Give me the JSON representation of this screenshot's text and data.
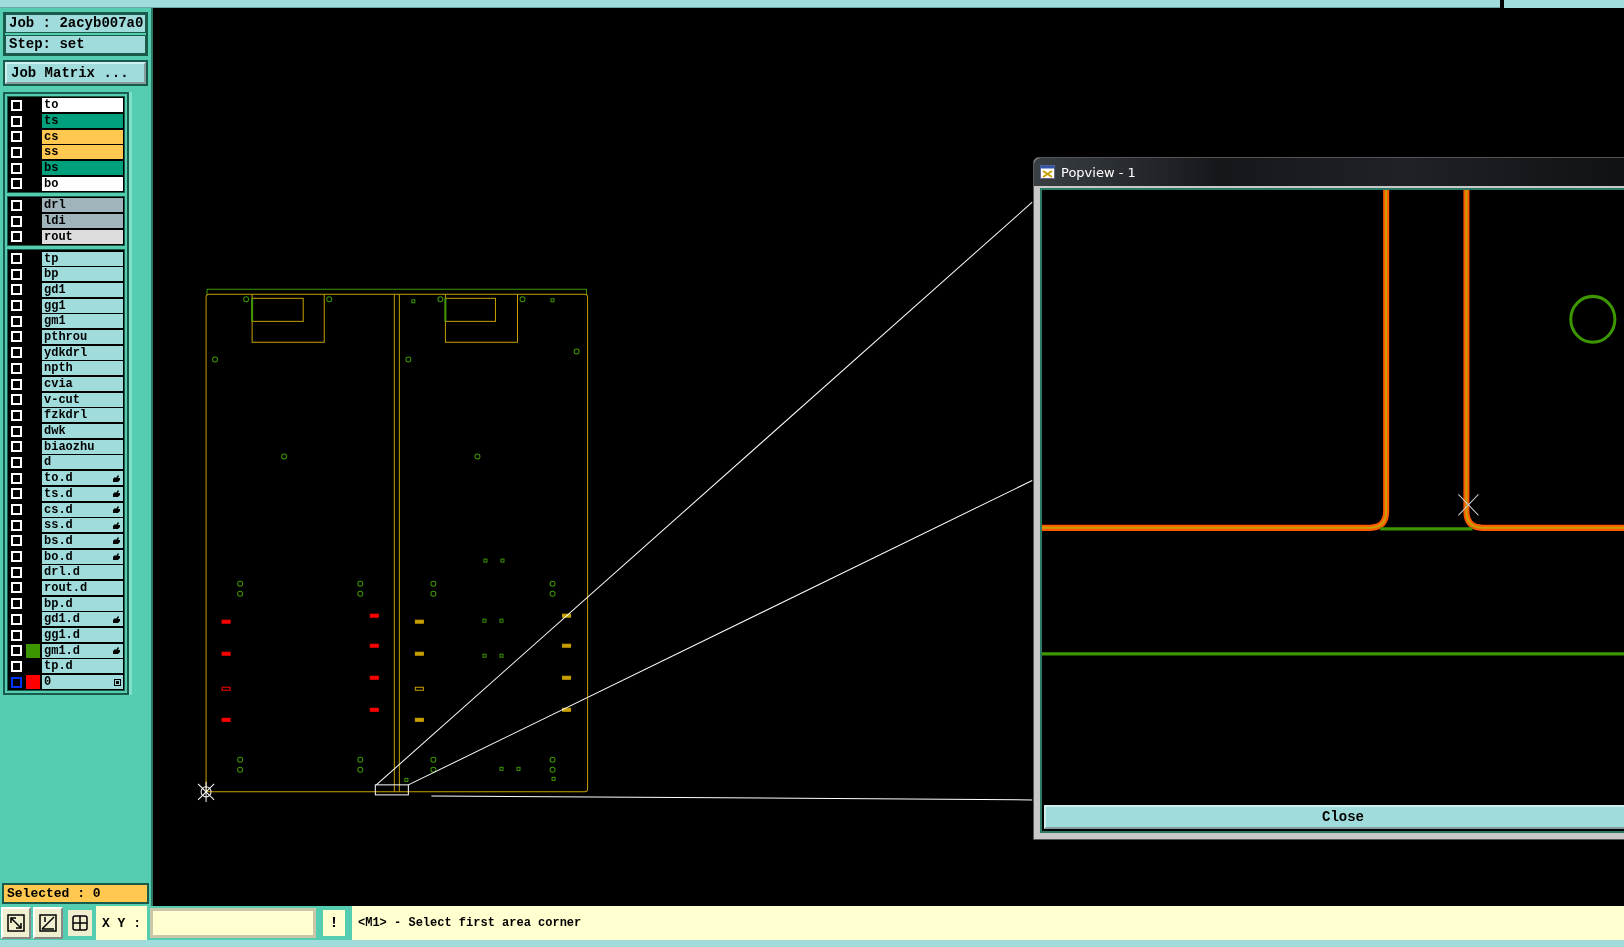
{
  "header": {
    "job": "Job : 2acyb007a0",
    "step": "Step: set",
    "matrix_button": "Job Matrix ..."
  },
  "layer_groups": [
    {
      "layers": [
        {
          "name": "to",
          "color": "#ffffff",
          "checked": false,
          "hand": false,
          "active": false
        },
        {
          "name": "ts",
          "color": "#00a07c",
          "checked": false,
          "hand": false,
          "active": false
        },
        {
          "name": "cs",
          "color": "#ffc850",
          "checked": false,
          "hand": false,
          "active": false
        },
        {
          "name": "ss",
          "color": "#ffc850",
          "checked": false,
          "hand": false,
          "active": false
        },
        {
          "name": "bs",
          "color": "#00a07c",
          "checked": false,
          "hand": false,
          "active": false
        },
        {
          "name": "bo",
          "color": "#ffffff",
          "checked": false,
          "hand": false,
          "active": false
        }
      ]
    },
    {
      "layers": [
        {
          "name": "drl",
          "color": "#a0b4bc",
          "checked": false,
          "hand": false,
          "active": false
        },
        {
          "name": "ldi",
          "color": "#a0b4bc",
          "checked": false,
          "hand": false,
          "active": false
        },
        {
          "name": "rout",
          "color": "#dcdcdc",
          "checked": false,
          "hand": false,
          "active": false
        }
      ]
    },
    {
      "layers": [
        {
          "name": "tp",
          "color": "#a0dcdc",
          "checked": false,
          "hand": false,
          "active": false
        },
        {
          "name": "bp",
          "color": "#a0dcdc",
          "checked": false,
          "hand": false,
          "active": false
        },
        {
          "name": "gd1",
          "color": "#a0dcdc",
          "checked": false,
          "hand": false,
          "active": false
        },
        {
          "name": "gg1",
          "color": "#a0dcdc",
          "checked": false,
          "hand": false,
          "active": false
        },
        {
          "name": "gm1",
          "color": "#a0dcdc",
          "checked": false,
          "hand": false,
          "active": false
        },
        {
          "name": "pthrou",
          "color": "#a0dcdc",
          "checked": false,
          "hand": false,
          "active": false
        },
        {
          "name": "ydkdrl",
          "color": "#a0dcdc",
          "checked": false,
          "hand": false,
          "active": false
        },
        {
          "name": "npth",
          "color": "#a0dcdc",
          "checked": false,
          "hand": false,
          "active": false
        },
        {
          "name": "cvia",
          "color": "#a0dcdc",
          "checked": false,
          "hand": false,
          "active": false
        },
        {
          "name": "v-cut",
          "color": "#a0dcdc",
          "checked": false,
          "hand": false,
          "active": false
        },
        {
          "name": "fzkdrl",
          "color": "#a0dcdc",
          "checked": false,
          "hand": false,
          "active": false
        },
        {
          "name": "dwk",
          "color": "#a0dcdc",
          "checked": false,
          "hand": false,
          "active": false
        },
        {
          "name": "biaozhu",
          "color": "#a0dcdc",
          "checked": false,
          "hand": false,
          "active": false
        },
        {
          "name": "d",
          "color": "#a0dcdc",
          "checked": false,
          "hand": false,
          "active": false
        },
        {
          "name": "to.d",
          "color": "#a0dcdc",
          "checked": false,
          "hand": true,
          "active": false
        },
        {
          "name": "ts.d",
          "color": "#a0dcdc",
          "checked": false,
          "hand": true,
          "active": false
        },
        {
          "name": "cs.d",
          "color": "#a0dcdc",
          "checked": false,
          "hand": true,
          "active": false
        },
        {
          "name": "ss.d",
          "color": "#a0dcdc",
          "checked": false,
          "hand": true,
          "active": false
        },
        {
          "name": "bs.d",
          "color": "#a0dcdc",
          "checked": false,
          "hand": true,
          "active": false
        },
        {
          "name": "bo.d",
          "color": "#a0dcdc",
          "checked": false,
          "hand": true,
          "active": false
        },
        {
          "name": "drl.d",
          "color": "#a0dcdc",
          "checked": false,
          "hand": false,
          "active": false
        },
        {
          "name": "rout.d",
          "color": "#a0dcdc",
          "checked": false,
          "hand": false,
          "active": false
        },
        {
          "name": "bp.d",
          "color": "#a0dcdc",
          "checked": false,
          "hand": false,
          "active": false
        },
        {
          "name": "gd1.d",
          "color": "#a0dcdc",
          "checked": false,
          "hand": true,
          "active": false
        },
        {
          "name": "gg1.d",
          "color": "#a0dcdc",
          "checked": false,
          "hand": false,
          "active": false
        },
        {
          "name": "gm1.d",
          "color": "#a0dcdc",
          "checked": false,
          "hand": true,
          "active": false,
          "swatch": {
            "color": "#3c9600"
          }
        },
        {
          "name": "tp.d",
          "color": "#a0dcdc",
          "checked": false,
          "hand": false,
          "active": false
        },
        {
          "name": "0",
          "color": "#a0dcdc",
          "checked": false,
          "hand": false,
          "active": true,
          "swatch": {
            "color": "#ff0000"
          }
        }
      ]
    }
  ],
  "selected_count": "Selected : 0",
  "toolbar": {
    "tools": [
      {
        "kind": "diagonal",
        "selected": false
      },
      {
        "kind": "angle",
        "selected": false
      },
      {
        "kind": "grid",
        "selected": true
      }
    ],
    "coord_label": "X Y :",
    "alert_button": "!",
    "prompt": "<M1> - Select first area corner"
  },
  "popview": {
    "title": "Popview - 1",
    "close_button": "Close"
  }
}
